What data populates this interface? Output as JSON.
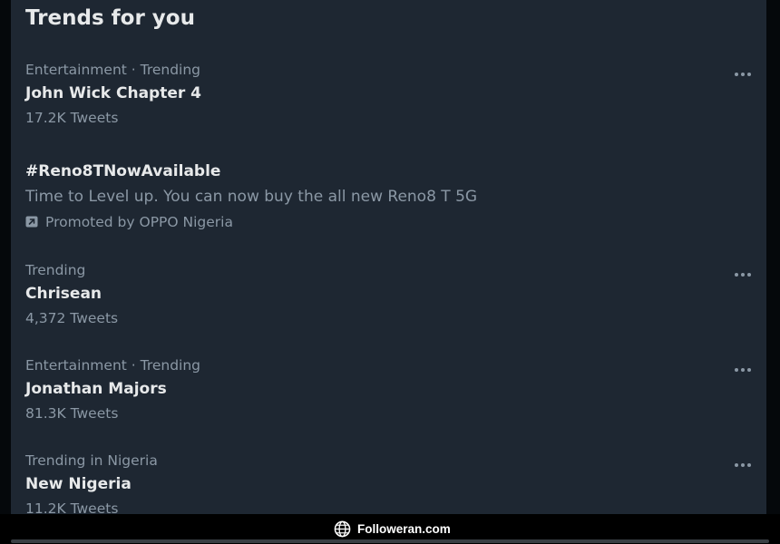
{
  "header": {
    "title": "Trends for you"
  },
  "trends": [
    {
      "meta": "Entertainment · Trending",
      "name": "John Wick Chapter 4",
      "count": "17.2K Tweets",
      "menu_icon": "more-horizontal-icon"
    },
    {
      "meta": "Trending",
      "name": "Chrisean",
      "count": "4,372 Tweets",
      "menu_icon": "more-horizontal-icon"
    },
    {
      "meta": "Entertainment · Trending",
      "name": "Jonathan Majors",
      "count": "81.3K Tweets",
      "menu_icon": "more-horizontal-icon"
    },
    {
      "meta": "Trending in Nigeria",
      "name": "New Nigeria",
      "count": "11.2K Tweets",
      "menu_icon": "more-horizontal-icon"
    }
  ],
  "promoted": {
    "name": "#Reno8TNowAvailable",
    "description": "Time to Level up. You can now buy the all new Reno8 T 5G",
    "promoted_by": "Promoted by OPPO Nigeria",
    "icon": "promoted-arrow-icon"
  },
  "footer": {
    "brand": "Followeran.com",
    "icon": "globe-icon"
  },
  "colors": {
    "panel_background": "#1e2732",
    "primary_text": "#e7e9ea",
    "secondary_text": "#8b98a5",
    "footer_background": "#000000"
  }
}
